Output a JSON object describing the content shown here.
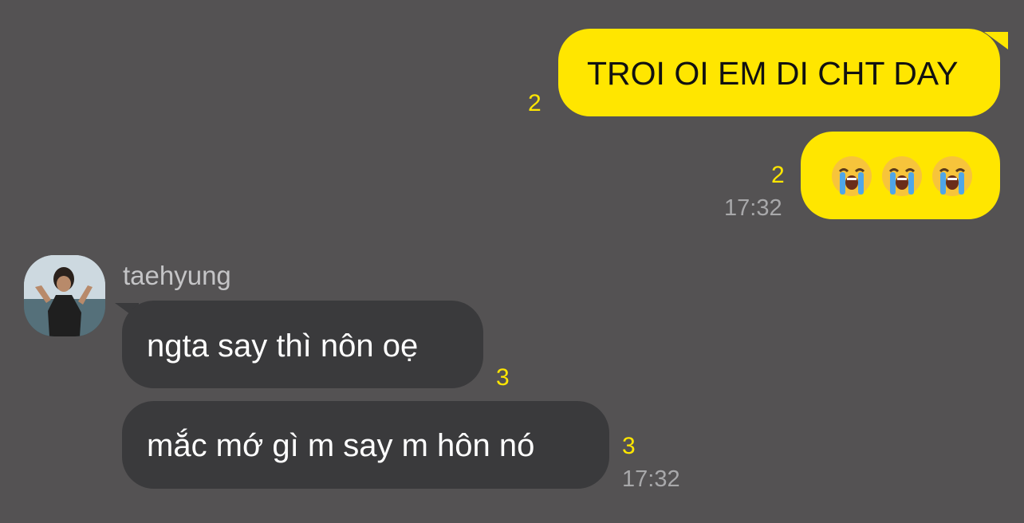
{
  "messages": {
    "m1": {
      "text": "TROI OI EM DI CHT DAY",
      "unread": "2"
    },
    "m2": {
      "emoji": [
        "loudly-crying-face",
        "loudly-crying-face",
        "loudly-crying-face"
      ],
      "unread": "2",
      "time": "17:32"
    },
    "sender": {
      "name": "taehyung"
    },
    "m3": {
      "text": "ngta say thì nôn oẹ",
      "unread": "3"
    },
    "m4": {
      "text": "mắc mớ gì m say m hôn nó",
      "unread": "3",
      "time": "17:32"
    }
  },
  "colors": {
    "background": "#545253",
    "my_bubble": "#ffe600",
    "their_bubble": "#3a3a3c",
    "unread_count": "#ffe600",
    "timestamp": "#a8a8aa"
  }
}
